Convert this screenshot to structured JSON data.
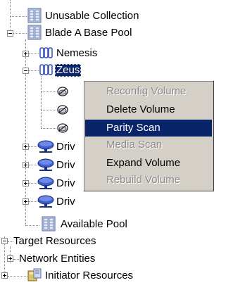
{
  "tree": {
    "unusable_collection": "Unusable Collection",
    "blade_pool": "Blade A Base Pool",
    "nemesis": "Nemesis",
    "zeus": "Zeus",
    "drive_label": "Driv",
    "available_pool": "Available Pool",
    "target_resources": "Target Resources",
    "network_entities": "Network Entities",
    "initiator_resources": "Initiator Resources"
  },
  "context_menu": {
    "items": [
      {
        "label": "Reconfig Volume",
        "state": "disabled"
      },
      {
        "label": "Delete Volume",
        "state": "enabled"
      },
      {
        "label": "Parity Scan",
        "state": "highlighted"
      },
      {
        "label": "Media Scan",
        "state": "disabled"
      },
      {
        "label": "Expand Volume",
        "state": "enabled"
      },
      {
        "label": "Rebuild Volume",
        "state": "disabled"
      }
    ]
  },
  "colors": {
    "selection": "#0a246a",
    "menu_bg": "#d4d0c8",
    "drive_icon": "#2f4fc0",
    "volume_icon": "#5a6ea8"
  }
}
